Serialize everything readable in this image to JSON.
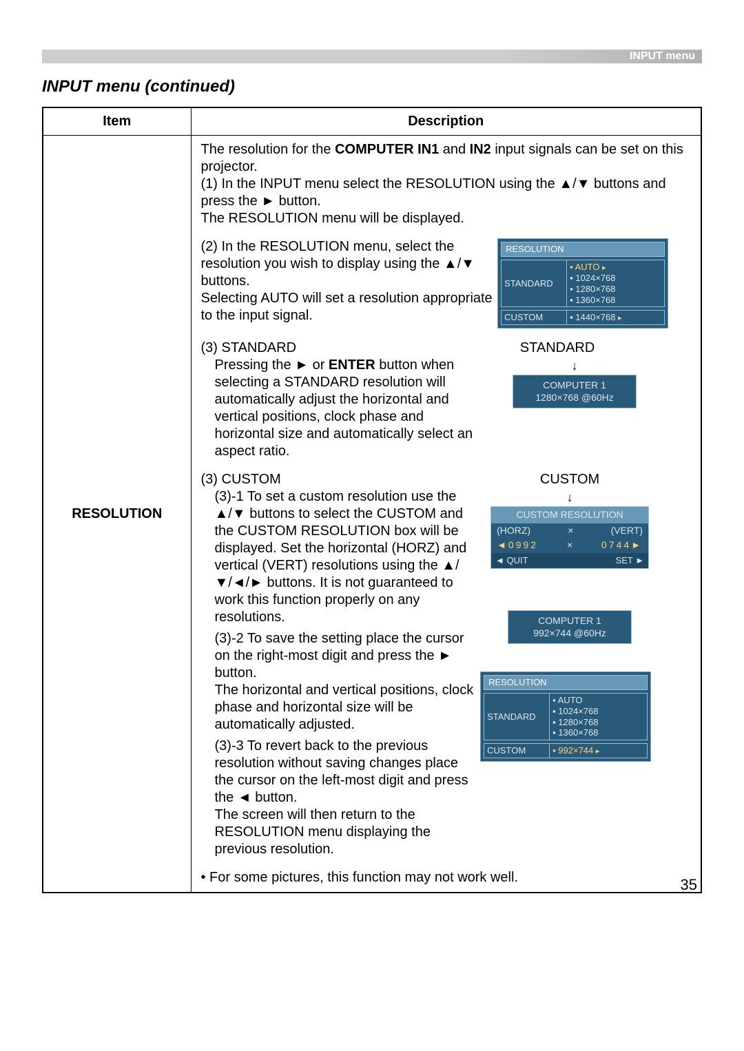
{
  "header": {
    "breadcrumb": "INPUT menu"
  },
  "section_title": "INPUT menu (continued)",
  "table": {
    "headers": {
      "item": "Item",
      "description": "Description"
    },
    "item_name": "RESOLUTION"
  },
  "desc": {
    "intro_a": "The resolution for the ",
    "intro_b": "COMPUTER IN1",
    "intro_c": " and ",
    "intro_d": "IN2",
    "intro_e": " input signals can be set on this projector.",
    "step1_a": "(1) In the INPUT menu select the RESOLUTION using the ▲/▼ buttons and press the ► button.",
    "step1_b": "The RESOLUTION menu will be displayed.",
    "step2": "(2) In the RESOLUTION menu, select the resolution you wish to display using the ▲/▼ buttons.",
    "step2_b": "Selecting AUTO will set a resolution appropriate to the input signal.",
    "step3s_h": "(3) STANDARD",
    "step3s_a": "Pressing the ► or ",
    "step3s_b": "ENTER",
    "step3s_c": " button when selecting a STANDARD resolution will automatically adjust the horizontal and vertical positions, clock phase and horizontal size and automatically select an aspect ratio.",
    "step3c_h": "(3) CUSTOM",
    "step3c_1": "(3)-1 To set a custom resolution use the ▲/▼ buttons to select the CUSTOM and the CUSTOM RESOLUTION box will be displayed. Set the horizontal (HORZ) and vertical (VERT) resolutions using the ▲/▼/◄/► buttons. It is not guaranteed to work this function properly on any resolutions.",
    "step3c_2": "(3)-2 To save the setting place the cursor on the right-most digit and press the ► button.",
    "step3c_2b": "The horizontal and vertical positions, clock phase and horizontal size will be automatically adjusted.",
    "step3c_3": "(3)-3 To revert back to the previous resolution without saving changes place the cursor on the left-most digit and press the ◄ button.",
    "step3c_3b": "The screen will then return to the RESOLUTION menu displaying the previous resolution.",
    "note": "• For some pictures, this function may not work well."
  },
  "osd1": {
    "title": "RESOLUTION",
    "standard": "STANDARD",
    "custom": "CUSTOM",
    "auto": "AUTO",
    "r1": "1024×768",
    "r2": "1280×768",
    "r3": "1360×768",
    "r4": "1440×768"
  },
  "std_panel": {
    "label": "STANDARD",
    "line1": "COMPUTER 1",
    "line2": "1280×768 @60Hz"
  },
  "custom_panel": {
    "label": "CUSTOM",
    "title": "CUSTOM RESOLUTION",
    "horz_lbl": "(HORZ)",
    "vert_lbl": "(VERT)",
    "x": "×",
    "horz_val": "0992",
    "vert_val": "0744",
    "quit": "◄ QUIT",
    "set": "SET ►"
  },
  "result_panel": {
    "line1": "COMPUTER 1",
    "line2": "992×744 @60Hz"
  },
  "osd2": {
    "title": "RESOLUTION",
    "standard": "STANDARD",
    "custom": "CUSTOM",
    "auto": "AUTO",
    "r1": "1024×768",
    "r2": "1280×768",
    "r3": "1360×768",
    "r4": "992×744"
  },
  "page_number": "35"
}
